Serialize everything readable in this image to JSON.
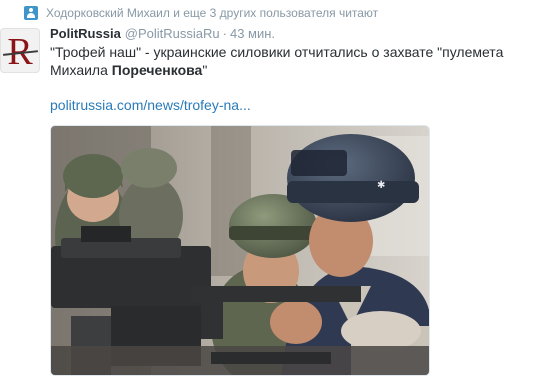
{
  "context": {
    "icon": "follower-icon",
    "text": "Ходорковский Михаил и еще 3 других пользователя читают"
  },
  "author": {
    "avatar_letter": "R",
    "fullname": "PolitRussia",
    "username": "@PolitRussiaRu",
    "separator": "·",
    "timestamp": "43 мин."
  },
  "tweet": {
    "text_before": "\"Трофей наш\" - украинские силовики отчитались о захвате \"пулемета Михаила ",
    "text_bold": "Пореченкова",
    "text_after": "\"",
    "link": "politrussia.com/news/trofey-na..."
  },
  "colors": {
    "link": "#2b7bb9",
    "muted": "#8899a6",
    "text": "#292f33"
  }
}
